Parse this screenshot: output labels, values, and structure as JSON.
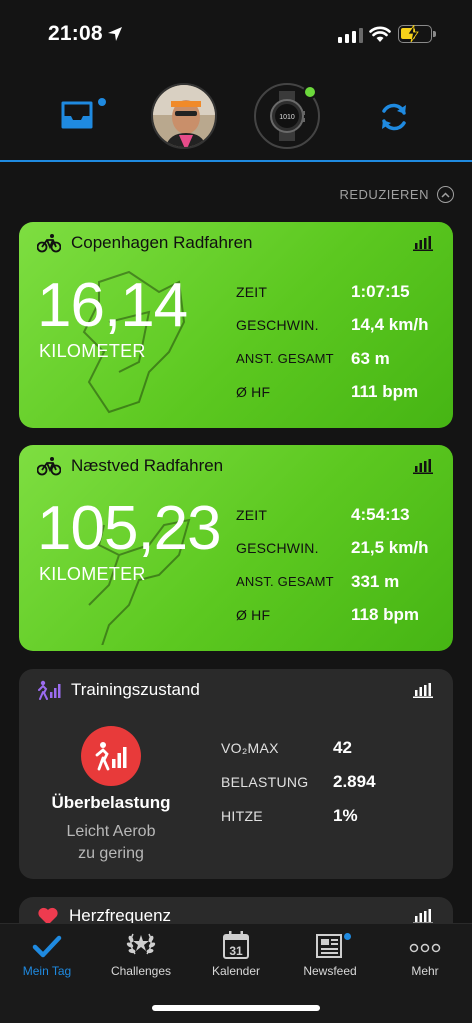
{
  "status_bar": {
    "time": "21:08"
  },
  "header": {
    "reduce_label": "REDUZIEREN"
  },
  "activities": [
    {
      "title": "Copenhagen Radfahren",
      "big_value": "16,14",
      "big_unit": "KILOMETER",
      "stats": [
        {
          "label": "ZEIT",
          "value": "1:07:15"
        },
        {
          "label": "GESCHWIN.",
          "value": "14,4 km/h"
        },
        {
          "label": "ANST. GESAMT",
          "value": "63 m"
        },
        {
          "label": "Ø HF",
          "value": "111 bpm"
        }
      ]
    },
    {
      "title": "Næstved Radfahren",
      "big_value": "105,23",
      "big_unit": "KILOMETER",
      "stats": [
        {
          "label": "ZEIT",
          "value": "4:54:13"
        },
        {
          "label": "GESCHWIN.",
          "value": "21,5 km/h"
        },
        {
          "label": "ANST. GESAMT",
          "value": "331 m"
        },
        {
          "label": "Ø HF",
          "value": "118 bpm"
        }
      ]
    }
  ],
  "training": {
    "title": "Trainingszustand",
    "status": "Überbelastung",
    "sub_line1": "Leicht Aerob",
    "sub_line2": "zu gering",
    "stats": [
      {
        "label": "VO₂MAX",
        "value": "42"
      },
      {
        "label": "BELASTUNG",
        "value": "2.894"
      },
      {
        "label": "HITZE",
        "value": "1%"
      }
    ]
  },
  "heart": {
    "title": "Herzfrequenz"
  },
  "tabs": [
    {
      "label": "Mein Tag",
      "icon": "check-icon"
    },
    {
      "label": "Challenges",
      "icon": "laurel-icon"
    },
    {
      "label": "Kalender",
      "icon": "calendar-icon",
      "calendar_day": "31"
    },
    {
      "label": "Newsfeed",
      "icon": "newspaper-icon"
    },
    {
      "label": "Mehr",
      "icon": "more-icon"
    }
  ],
  "colors": {
    "accent": "#1f8ae0",
    "activity_green": "#5cc820",
    "overload_red": "#e83a3a",
    "watch_dot": "#6cd83c"
  }
}
